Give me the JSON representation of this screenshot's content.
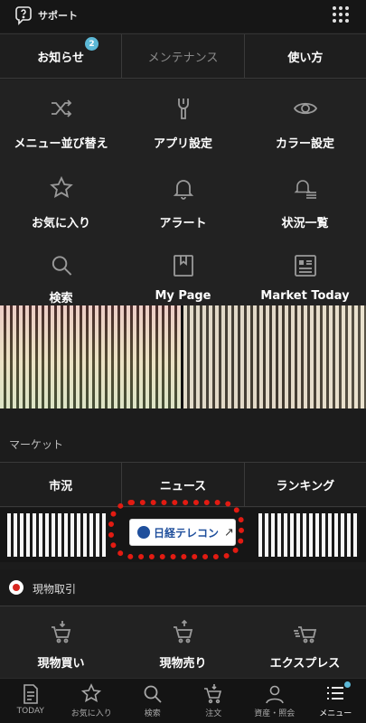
{
  "top_bar": {
    "support_label": "サポート",
    "support_icon": "question-bubble-icon",
    "grid_icon": "apps-grid-icon"
  },
  "header_tabs": [
    {
      "label": "お知らせ",
      "badge": "2"
    },
    {
      "label": "メンテナンス"
    },
    {
      "label": "使い方"
    }
  ],
  "menu": [
    {
      "label": "メニュー並び替え",
      "icon": "shuffle-icon"
    },
    {
      "label": "アプリ設定",
      "icon": "wrench-icon"
    },
    {
      "label": "カラー設定",
      "icon": "eye-icon"
    },
    {
      "label": "お気に入り",
      "icon": "star-icon"
    },
    {
      "label": "アラート",
      "icon": "bell-icon"
    },
    {
      "label": "状況一覧",
      "icon": "bell-list-icon"
    },
    {
      "label": "検索",
      "icon": "search-icon"
    },
    {
      "label": "My Page",
      "icon": "bookmark-icon"
    },
    {
      "label": "Market Today",
      "icon": "newspaper-icon"
    }
  ],
  "market": {
    "section_label": "マーケット",
    "tabs": [
      "市況",
      "ニュース",
      "ランキング"
    ],
    "partner_highlight": "日経テレコン",
    "partner_arrow": "↗"
  },
  "cash_trading": {
    "section_label": "現物取引",
    "items": [
      {
        "label": "現物買い",
        "icon": "cart-buy-icon"
      },
      {
        "label": "現物売り",
        "icon": "cart-sell-icon"
      },
      {
        "label": "エクスプレス",
        "icon": "cart-express-icon"
      }
    ]
  },
  "bottom_nav": [
    {
      "label": "TODAY",
      "icon": "today-doc-icon"
    },
    {
      "label": "お気に入り",
      "icon": "star-icon"
    },
    {
      "label": "検索",
      "icon": "search-icon"
    },
    {
      "label": "注文",
      "icon": "cart-order-icon"
    },
    {
      "label": "資産・照会",
      "icon": "person-icon"
    },
    {
      "label": "メニュー",
      "icon": "menu-list-icon",
      "active": true
    }
  ],
  "colors": {
    "background": "#1c1c1c",
    "badge": "#5cb8d6",
    "highlight_outline": "#e21b12"
  }
}
